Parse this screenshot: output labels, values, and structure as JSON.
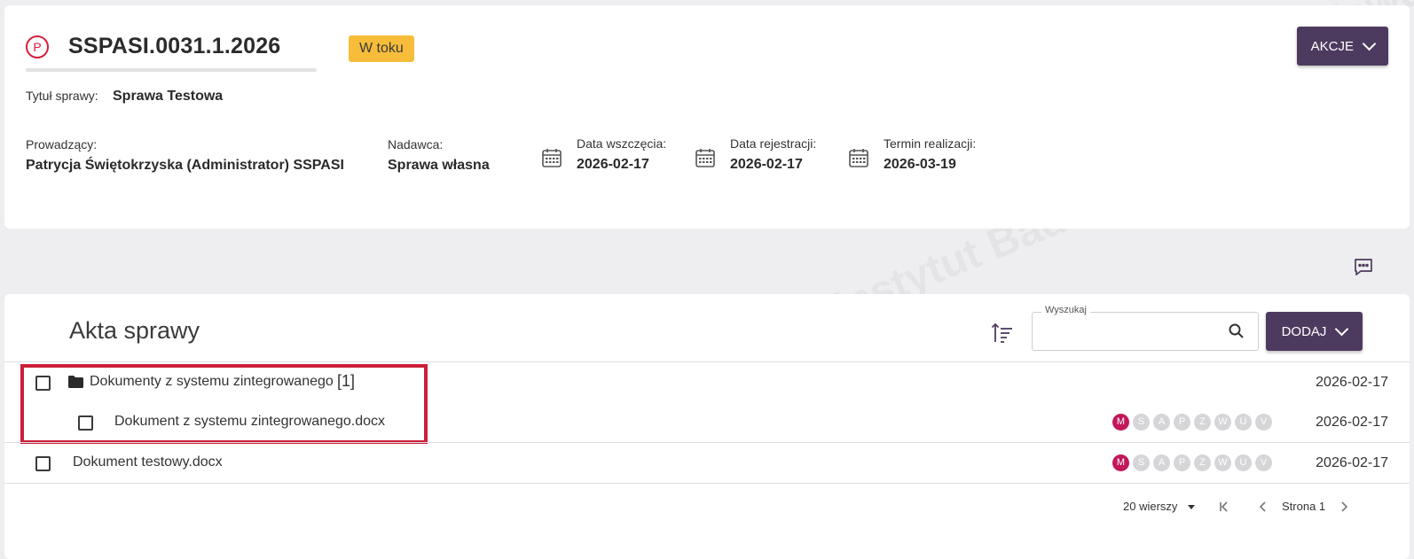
{
  "header": {
    "case_icon_letter": "P",
    "case_number": "SSPASI.0031.1.2026",
    "status": "W toku",
    "actions_label": "AKCJE",
    "title_label": "Tytuł sprawy:",
    "title_value": "Sprawa Testowa",
    "owner_label": "Prowadzący:",
    "owner_value": "Patrycja Świętokrzyska (Administrator) SSPASI",
    "sender_label": "Nadawca:",
    "sender_value": "Sprawa własna",
    "start_date_label": "Data wszczęcia:",
    "start_date_value": "2026-02-17",
    "registration_date_label": "Data rejestracji:",
    "registration_date_value": "2026-02-17",
    "deadline_label": "Termin realizacji:",
    "deadline_value": "2026-03-19"
  },
  "files": {
    "title": "Akta sprawy",
    "search_label": "Wyszukaj",
    "search_value": "",
    "add_label": "DODAJ",
    "folder": {
      "name": "Dokumenty z systemu zintegrowanego",
      "count": "[1]",
      "date": "2026-02-17"
    },
    "rows": [
      {
        "name": "Dokument z systemu zintegrowanego.docx",
        "date": "2026-02-17"
      },
      {
        "name": "Dokument testowy.docx",
        "date": "2026-02-17"
      }
    ],
    "status_letters": [
      "M",
      "S",
      "A",
      "P",
      "Z",
      "W",
      "U",
      "V"
    ]
  },
  "pagination": {
    "rows_per_page": "20 wierszy",
    "page_label": "Strona 1"
  },
  "colors": {
    "accent": "#4d3b5f",
    "status_badge": "#f7bd3a",
    "highlight": "#cc1f3a",
    "active_letter": "#c2185b"
  }
}
